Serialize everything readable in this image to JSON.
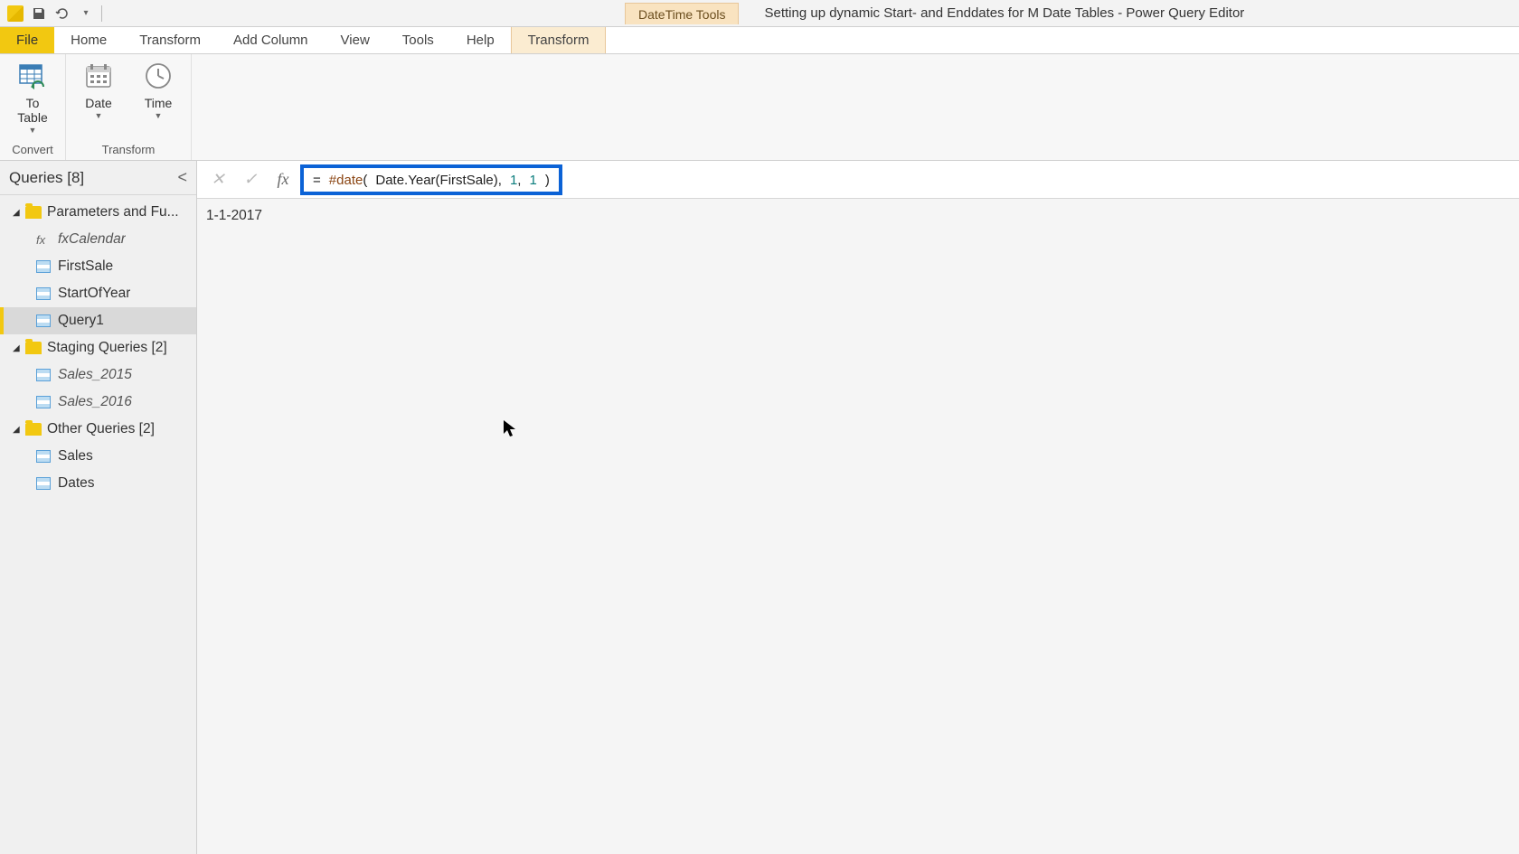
{
  "title_bar": {
    "context_tool_title": "DateTime Tools",
    "window_title": "Setting up dynamic Start- and Enddates for M Date Tables - Power Query Editor"
  },
  "ribbon_tabs": {
    "file": "File",
    "home": "Home",
    "transform": "Transform",
    "add_column": "Add Column",
    "view": "View",
    "tools": "Tools",
    "help": "Help",
    "context_transform": "Transform"
  },
  "ribbon": {
    "convert": {
      "to_table": "To\nTable",
      "group_label": "Convert"
    },
    "transform": {
      "date": "Date",
      "time": "Time",
      "group_label": "Transform"
    }
  },
  "queries": {
    "header": "Queries [8]",
    "groups": [
      {
        "label": "Parameters and Fu...",
        "items": [
          {
            "label": "fxCalendar",
            "type": "fx",
            "italic": true
          },
          {
            "label": "FirstSale",
            "type": "table"
          },
          {
            "label": "StartOfYear",
            "type": "table"
          },
          {
            "label": "Query1",
            "type": "table",
            "selected": true
          }
        ]
      },
      {
        "label": "Staging Queries [2]",
        "items": [
          {
            "label": "Sales_2015",
            "type": "table",
            "italic": true
          },
          {
            "label": "Sales_2016",
            "type": "table",
            "italic": true
          }
        ]
      },
      {
        "label": "Other Queries [2]",
        "items": [
          {
            "label": "Sales",
            "type": "table"
          },
          {
            "label": "Dates",
            "type": "table"
          }
        ]
      }
    ]
  },
  "formula": {
    "prefix_eq": "=",
    "date_fn": "#date",
    "open": "(",
    "year_fn": "Date.Year",
    "open2": "(",
    "arg_ref": "FirstSale",
    "close2": ")",
    "comma1": ",",
    "num1": "1",
    "comma2": ",",
    "num2": "1",
    "close": ")"
  },
  "result": {
    "value": "1-1-2017"
  }
}
